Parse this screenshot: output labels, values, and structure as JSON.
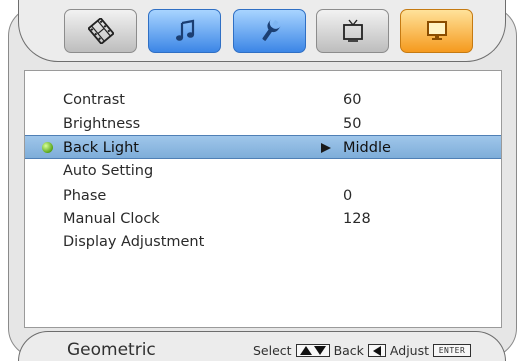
{
  "tabs": [
    {
      "icon": "film-icon",
      "style": "gray"
    },
    {
      "icon": "music-note-icon",
      "style": "blue"
    },
    {
      "icon": "wrench-icon",
      "style": "blue"
    },
    {
      "icon": "tv-icon",
      "style": "gray"
    },
    {
      "icon": "monitor-icon",
      "style": "orange",
      "active": true
    }
  ],
  "menu": {
    "items": [
      {
        "label": "Contrast",
        "value": "60"
      },
      {
        "label": "Brightness",
        "value": "50"
      },
      {
        "label": "Back Light",
        "value": "Middle",
        "selected": true
      },
      {
        "label": "Auto Setting",
        "value": ""
      },
      {
        "label": "Phase",
        "value": "0"
      },
      {
        "label": "Manual Clock",
        "value": "128"
      },
      {
        "label": "Display Adjustment",
        "value": ""
      }
    ]
  },
  "footer": {
    "menu_name": "Geometric",
    "select_label": "Select",
    "back_label": "Back",
    "adjust_label": "Adjust",
    "enter_key": "ENTER"
  },
  "colors": {
    "selected_row": "#8fb9e2",
    "accent_blue": "#3c86e6",
    "active_tab": "#f59a1e",
    "bullet_green": "#58a51b"
  }
}
